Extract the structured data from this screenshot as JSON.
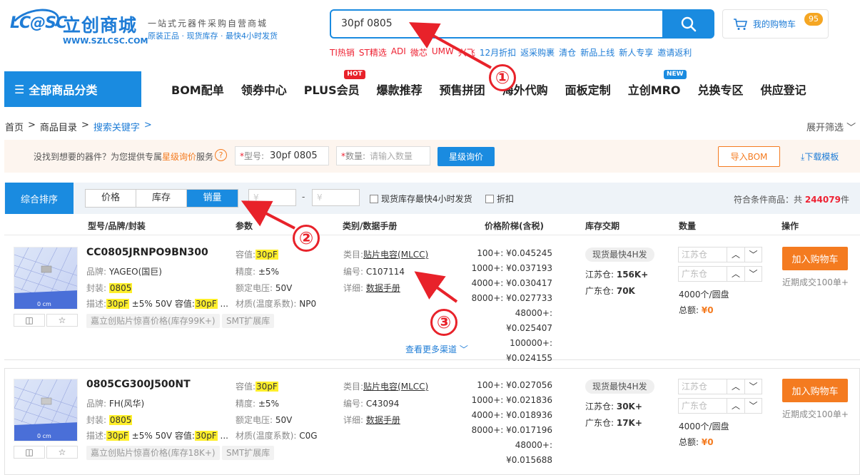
{
  "header": {
    "logo_mark": "LC@SC",
    "logo_cn": "立创商城",
    "logo_url": "WWW.SZLCSC.COM",
    "slogan1": "一站式元器件采购自营商城",
    "slogan2": "原装正品 · 现货库存 · 最快4小时发货",
    "search_value": "30pf 0805",
    "hot_links": [
      {
        "label": "TI热销",
        "red": true
      },
      {
        "label": "ST精选",
        "red": true
      },
      {
        "label": "ADI",
        "red": true
      },
      {
        "label": "微芯",
        "red": true
      },
      {
        "label": "UMW",
        "red": true
      },
      {
        "label": "兴飞",
        "red": true
      },
      {
        "label": "12月折扣",
        "red": false
      },
      {
        "label": "返采购裹",
        "red": false
      },
      {
        "label": "清仓",
        "red": false
      },
      {
        "label": "新品上线",
        "red": false
      },
      {
        "label": "新人专享",
        "red": false
      },
      {
        "label": "邀请返利",
        "red": false
      }
    ],
    "cart_label": "我的购物车",
    "cart_count": "95"
  },
  "nav": {
    "category_label": "全部商品分类",
    "items": [
      "BOM配单",
      "领券中心",
      "PLUS会员",
      "爆款推荐",
      "预售拼团",
      "海外代购",
      "面板定制",
      "立创MRO",
      "兑换专区",
      "供应登记"
    ],
    "hot_tag": "HOT",
    "new_tag": "NEW"
  },
  "breadcrumb": {
    "home": "首页",
    "sep": ">",
    "catalog": "商品目录",
    "keyword": "搜索关键字",
    "expand": "展开筛选"
  },
  "inquiry": {
    "text_pre": "没找到想要的器件？为您提供专属",
    "text_highlight": "星级询价",
    "text_post": "服务",
    "model_label": "型号:",
    "model_value": "30pf 0805",
    "qty_label": "数量:",
    "qty_placeholder": "请输入数量",
    "submit": "星级询价",
    "import_bom": "导入BOM",
    "download": "下载模板"
  },
  "sortbar": {
    "main": "综合排序",
    "options": [
      "价格",
      "库存",
      "销量"
    ],
    "price_ph": "¥",
    "dash": "-",
    "chk1": "现货库存最快4小时发货",
    "chk2": "折扣",
    "total_pre": "符合条件商品：共",
    "total_num": "244079",
    "total_post": "件"
  },
  "table_headers": [
    "型号/品牌/封装",
    "参数",
    "类别/数据手册",
    "价格阶梯(含税)",
    "库存交期",
    "数量",
    "操作"
  ],
  "products": [
    {
      "pn": "CC0805JRNPO9BN300",
      "brand_k": "品牌:",
      "brand": "YAGEO(国巨)",
      "pkg_k": "封装:",
      "pkg": "0805",
      "desc_k": "描述:",
      "desc_hl": "30pF",
      "desc_mid": "±5% 50V 容值:",
      "desc_hl2": "30pF",
      "desc_tail": "...",
      "cap_k": "容值:",
      "cap": "30pF",
      "tol_k": "精度:",
      "tol": "±5%",
      "volt_k": "额定电压:",
      "volt": "50V",
      "mat_k": "材质(温度系数):",
      "mat": "NP0",
      "cat_k": "类目:",
      "cat": "贴片电容(MLCC)",
      "code_k": "编号:",
      "code": "C107114",
      "sheet_k": "详细:",
      "sheet": "数据手册",
      "chip1": "嘉立创贴片惊喜价格(库存99K+)",
      "chip2": "SMT扩展库",
      "prices": [
        "100+: ¥0.045245",
        "1000+: ¥0.037193",
        "4000+: ¥0.030417",
        "8000+: ¥0.027733",
        "48000+: ¥0.025407",
        "100000+: ¥0.024155"
      ],
      "stock_tag": "现货最快4H发",
      "js": "江苏仓: ",
      "js_val": "156K+",
      "gd": "广东仓: ",
      "gd_val": "70K",
      "qty_js": "江苏仓",
      "qty_gd": "广东仓",
      "reel": "4000个/圆盘",
      "total_k": "总额:",
      "total": "¥0",
      "add": "加入购物车",
      "recent": "近期成交100单+"
    },
    {
      "pn": "0805CG300J500NT",
      "brand_k": "品牌:",
      "brand": "FH(风华)",
      "pkg_k": "封装:",
      "pkg": "0805",
      "desc_k": "描述:",
      "desc_hl": "30pF",
      "desc_mid": "±5% 50V 容值:",
      "desc_hl2": "30pF",
      "desc_tail": "...",
      "cap_k": "容值:",
      "cap": "30pF",
      "tol_k": "精度:",
      "tol": "±5%",
      "volt_k": "额定电压:",
      "volt": "50V",
      "mat_k": "材质(温度系数):",
      "mat": "C0G",
      "cat_k": "类目:",
      "cat": "贴片电容(MLCC)",
      "code_k": "编号:",
      "code": "C43094",
      "sheet_k": "详细:",
      "sheet": "数据手册",
      "chip1": "嘉立创贴片惊喜价格(库存18K+)",
      "chip2": "SMT扩展库",
      "prices": [
        "100+: ¥0.027056",
        "1000+: ¥0.021836",
        "4000+: ¥0.018936",
        "8000+: ¥0.017196",
        "48000+: ¥0.015688"
      ],
      "stock_tag": "现货最快4H发",
      "js": "江苏仓: ",
      "js_val": "30K+",
      "gd": "广东仓: ",
      "gd_val": "17K+",
      "qty_js": "江苏仓",
      "qty_gd": "广东仓",
      "reel": "4000个/圆盘",
      "total_k": "总额:",
      "total": "¥0",
      "add": "加入购物车",
      "recent": "近期成交100单+"
    }
  ],
  "more_channels": "查看更多渠道",
  "annotations": [
    "①",
    "②",
    "③"
  ],
  "colors": {
    "primary": "#1a8be0",
    "orange": "#f47b20",
    "annotation": "#e8222a",
    "highlight": "#ffef2b"
  }
}
